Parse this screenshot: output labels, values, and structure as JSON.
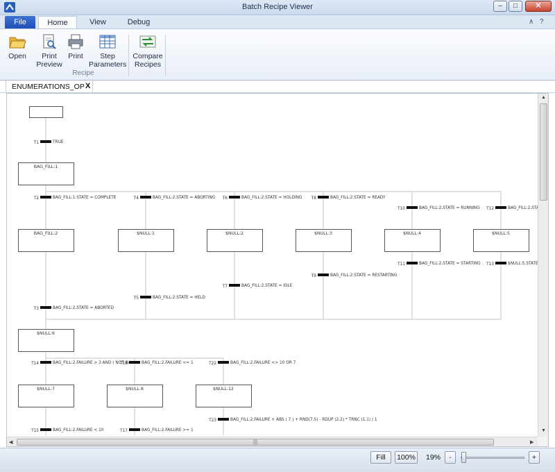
{
  "window": {
    "title": "Batch Recipe Viewer",
    "min_glyph": "–",
    "max_glyph": "□",
    "close_glyph": "✕"
  },
  "ribbon_tabs": {
    "file": "File",
    "home": "Home",
    "view": "View",
    "debug": "Debug"
  },
  "help_glyphs": {
    "collapse": "∧",
    "help": "?"
  },
  "ribbon": {
    "open": "Open",
    "print_preview": [
      "Print",
      "Preview"
    ],
    "print": "Print",
    "step_parameters": [
      "Step",
      "Parameters"
    ],
    "compare_recipes": [
      "Compare",
      "Recipes"
    ],
    "group_label": "Recipe"
  },
  "document_tab": {
    "label": "ENUMERATIONS_OP",
    "close": "X"
  },
  "diagram": {
    "steps": [
      "",
      "BAG_FILL:1",
      "BAG_FILL:2",
      "$NULL:1",
      "$NULL:2",
      "$NULL:3",
      "$NULL:4",
      "$NULL:5",
      "$NULL:6",
      "$NULL:7",
      "$NULL:8",
      "$NULL:12"
    ],
    "transitions": [
      {
        "id": "T1",
        "cond": "TRUE"
      },
      {
        "id": "T2",
        "cond": "BAG_FILL:1.STATE = COMPLETE"
      },
      {
        "id": "T4",
        "cond": "BAG_FILL:2.STATE = ABORTING"
      },
      {
        "id": "T6",
        "cond": "BAG_FILL:2.STATE = HOLDING"
      },
      {
        "id": "T8",
        "cond": "BAG_FILL:2.STATE = READY"
      },
      {
        "id": "T10",
        "cond": "BAG_FILL:2.STATE = RUNNING"
      },
      {
        "id": "T12",
        "cond": "BAG_FILL:2.STAT"
      },
      {
        "id": "T11",
        "cond": "BAG_FILL:2.STATE = STARTING"
      },
      {
        "id": "T13",
        "cond": "$NULL:5.STATE"
      },
      {
        "id": "T9",
        "cond": "BAG_FILL:2.STATE = RESTARTING"
      },
      {
        "id": "T7",
        "cond": "BAG_FILL:2.STATE = IDLE"
      },
      {
        "id": "T5",
        "cond": "BAG_FILL:2.STATE = HELD"
      },
      {
        "id": "T3",
        "cond": "BAG_FILL:2.STATE = ABORTED"
      },
      {
        "id": "T14",
        "cond": "BAG_FILL:2.FAILURE > 3 AND ( NOT BA"
      },
      {
        "id": "T16",
        "cond": "BAG_FILL:2.FAILURE <= 1"
      },
      {
        "id": "T22",
        "cond": "BAG_FILL:2.FAILURE <> 10 OR 7"
      },
      {
        "id": "T23",
        "cond": "BAG_FILL:2.FAILURE + ABS ( 7 ) + RND(7.5) - RDUP (2.2) * TRNC (1.1) / 1"
      },
      {
        "id": "T15",
        "cond": "BAG_FILL:2.FAILURE < 10"
      },
      {
        "id": "T17",
        "cond": "BAG_FILL:2.FAILURE >= 1"
      }
    ]
  },
  "scroll": {
    "h_grip": "|||"
  },
  "statusbar": {
    "fill": "Fill",
    "hundred": "100%",
    "zoom": "19%",
    "minus": "-",
    "plus": "+"
  }
}
